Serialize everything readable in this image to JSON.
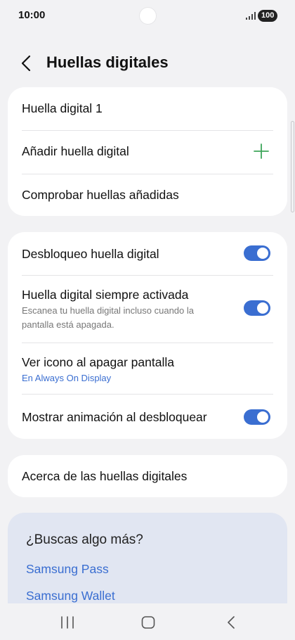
{
  "status_bar": {
    "time": "10:00",
    "battery": "100"
  },
  "header": {
    "title": "Huellas digitales"
  },
  "card1": {
    "items": [
      {
        "label": "Huella digital 1"
      },
      {
        "label": "Añadir huella digital"
      },
      {
        "label": "Comprobar huellas añadidas"
      }
    ]
  },
  "card2": {
    "items": [
      {
        "label": "Desbloqueo huella digital",
        "toggle": true
      },
      {
        "label": "Huella digital siempre activada",
        "subtitle": "Escanea tu huella digital incluso cuando la pantalla está apagada.",
        "toggle": true
      },
      {
        "label": "Ver icono al apagar pantalla",
        "subtitle": "En Always On Display"
      },
      {
        "label": "Mostrar animación al desbloquear",
        "toggle": true
      }
    ]
  },
  "card3": {
    "label": "Acerca de las huellas digitales"
  },
  "suggestions": {
    "title": "¿Buscas algo más?",
    "links": [
      "Samsung Pass",
      "Samsung Wallet"
    ]
  },
  "colors": {
    "accent": "#3a6ed1",
    "plus": "#3ea55a",
    "background": "#f2f2f4"
  }
}
